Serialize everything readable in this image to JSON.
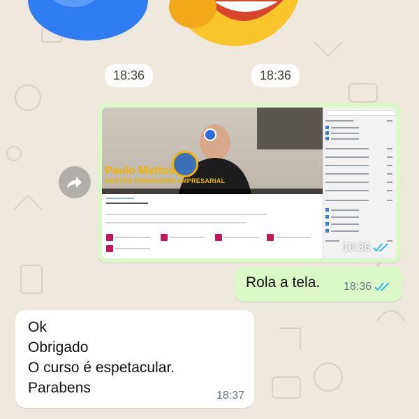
{
  "chat": {
    "sticker_times": [
      "18:36",
      "18:36"
    ],
    "image_message": {
      "time": "18:36",
      "status": "read",
      "screenshot": {
        "presenter_name": "Paulo Mattos",
        "presenter_subtitle": "GESTÃO FINANCEIRA EMPRESARIAL"
      }
    },
    "outgoing_text": {
      "text": "Rola a tela.",
      "time": "18:36",
      "status": "read"
    },
    "incoming_text": {
      "lines": [
        "Ok",
        "Obrigado",
        "O curso é espetacular.",
        "Parabens"
      ],
      "time": "18:37"
    }
  },
  "icons": {
    "forward": "forward-icon",
    "read_receipt": "double-check-icon"
  },
  "colors": {
    "wallpaper": "#efe8df",
    "outgoing_bubble": "#dcf8c6",
    "incoming_bubble": "#ffffff",
    "read_tick": "#34b7f1",
    "brand_gold": "#f0b400"
  }
}
